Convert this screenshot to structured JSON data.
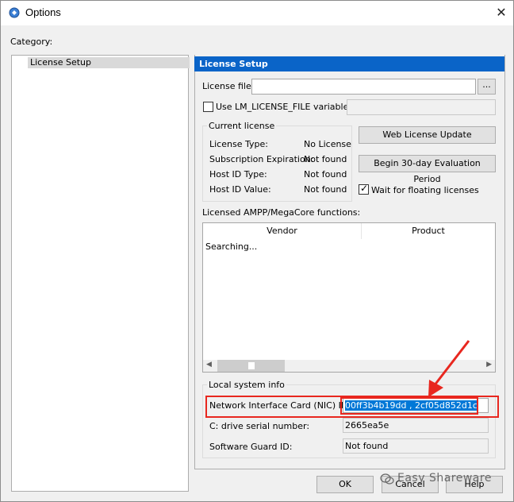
{
  "window": {
    "title": "Options",
    "close_glyph": "✕"
  },
  "category": {
    "label": "Category:",
    "items": [
      {
        "label": "License Setup"
      }
    ]
  },
  "panel": {
    "heading": "License Setup",
    "license_file_label": "License file:",
    "license_file_value": "",
    "browse_label": "...",
    "use_lm_label": "Use LM_LICENSE_FILE variable:",
    "use_lm_checked": false,
    "lm_value": ""
  },
  "current_license": {
    "title": "Current license",
    "rows": [
      {
        "label": "License Type:",
        "value": "No License"
      },
      {
        "label": "Subscription Expiration:",
        "value": "Not found"
      },
      {
        "label": "Host ID Type:",
        "value": "Not found"
      },
      {
        "label": "Host ID Value:",
        "value": "Not found"
      }
    ]
  },
  "buttons": {
    "web_update": "Web License Update",
    "evaluation": "Begin 30-day Evaluation Period",
    "ok": "OK",
    "cancel": "Cancel",
    "help": "Help"
  },
  "wait_floating": {
    "label": "Wait for floating licenses",
    "checked": true
  },
  "functions": {
    "label": "Licensed AMPP/MegaCore functions:",
    "columns": [
      "Vendor",
      "Product"
    ],
    "status_text": "Searching..."
  },
  "local_system": {
    "title": "Local system info",
    "nic_label": "Network Interface Card (NIC) ID:",
    "nic_value": "00ff3b4b19dd , 2cf05d852d1c",
    "drive_label": "C: drive serial number:",
    "drive_value": "2665ea5e",
    "guard_label": "Software Guard ID:",
    "guard_value": "Not found"
  },
  "watermark": {
    "text": "Easy Shareware"
  },
  "colors": {
    "header_blue": "#0a64c8",
    "highlight_red": "#e8271f",
    "selection_blue": "#0078d7"
  },
  "icons": [
    "app-icon",
    "close-icon",
    "checkbox-icon",
    "scroll-left-icon",
    "scroll-right-icon",
    "annotation-arrow-icon",
    "wechat-icon"
  ]
}
